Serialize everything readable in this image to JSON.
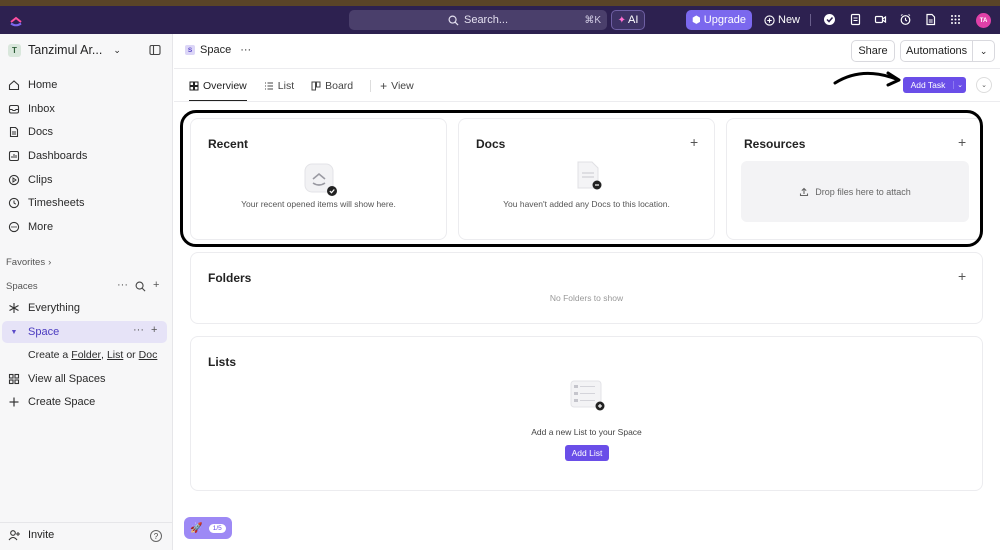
{
  "topbar": {
    "search_placeholder": "Search...",
    "search_shortcut": "⌘K",
    "ai_label": "AI",
    "upgrade_label": "Upgrade",
    "new_label": "New",
    "avatar_initials": "TA"
  },
  "sidebar": {
    "workspace_initial": "T",
    "workspace_name": "Tanzimul Ar...",
    "nav": [
      {
        "label": "Home",
        "icon": "home-icon"
      },
      {
        "label": "Inbox",
        "icon": "inbox-icon"
      },
      {
        "label": "Docs",
        "icon": "docs-icon"
      },
      {
        "label": "Dashboards",
        "icon": "dashboards-icon"
      },
      {
        "label": "Clips",
        "icon": "clips-icon"
      },
      {
        "label": "Timesheets",
        "icon": "timesheets-icon"
      },
      {
        "label": "More",
        "icon": "more-icon"
      }
    ],
    "favorites_label": "Favorites",
    "spaces_label": "Spaces",
    "everything_label": "Everything",
    "space_label": "Space",
    "create_prefix": "Create a",
    "create_folder": "Folder",
    "create_list": "List",
    "create_or": "or",
    "create_doc": "Doc",
    "view_all_spaces": "View all Spaces",
    "create_space": "Create Space",
    "invite_label": "Invite"
  },
  "header": {
    "space_badge": "S",
    "breadcrumb": "Space",
    "share_label": "Share",
    "automations_label": "Automations"
  },
  "tabs": [
    {
      "label": "Overview",
      "active": true
    },
    {
      "label": "List",
      "active": false
    },
    {
      "label": "Board",
      "active": false
    },
    {
      "label": "View",
      "active": false
    }
  ],
  "add_task_label": "Add Task",
  "cards": {
    "recent": {
      "title": "Recent",
      "empty": "Your recent opened items will show here."
    },
    "docs": {
      "title": "Docs",
      "empty": "You haven't added any Docs to this location."
    },
    "resources": {
      "title": "Resources",
      "dropzone": "Drop files here to attach"
    },
    "folders": {
      "title": "Folders",
      "empty": "No Folders to show"
    },
    "lists": {
      "title": "Lists",
      "empty": "Add a new List to your Space",
      "button": "Add List"
    }
  },
  "onboarding": {
    "progress": "1/5"
  },
  "colors": {
    "accent": "#6a4ee8",
    "topbar": "#2d2150",
    "upgrade": "#7b68ee"
  }
}
